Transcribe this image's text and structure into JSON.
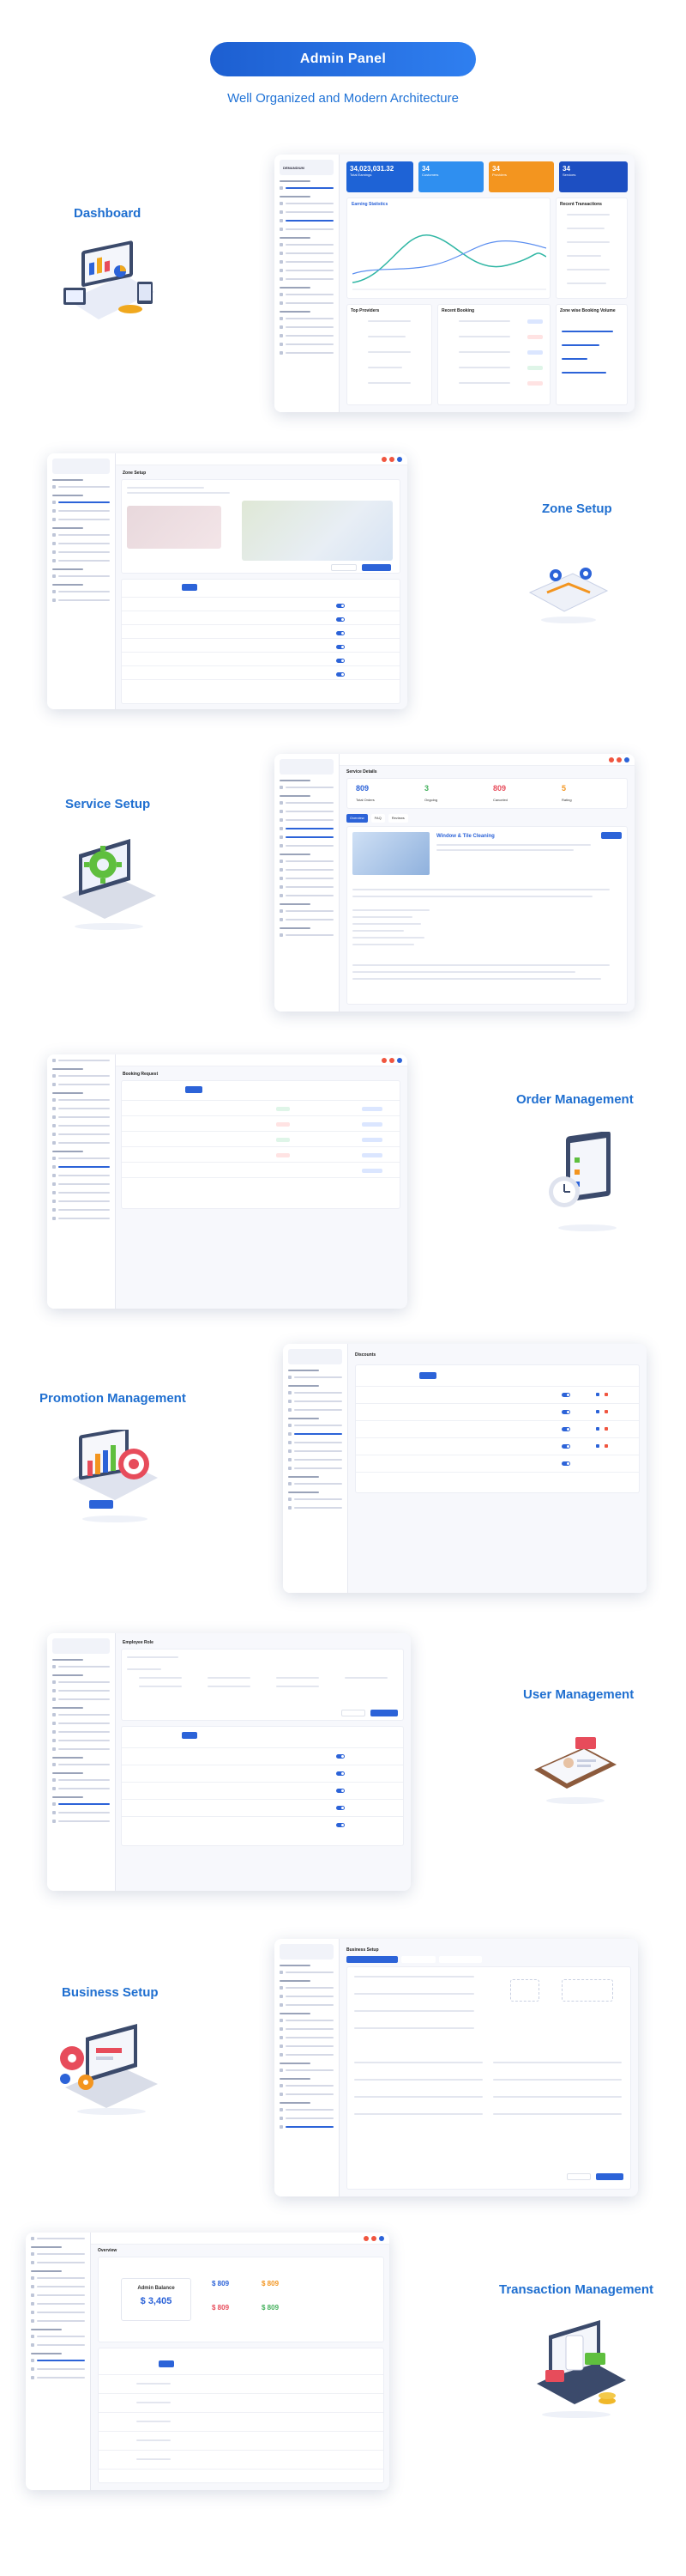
{
  "hero": {
    "button_label": "Admin Panel",
    "subtitle": "Well Organized and Modern Architecture"
  },
  "sections": [
    {
      "title": "Dashboard"
    },
    {
      "title": "Zone Setup"
    },
    {
      "title": "Service Setup"
    },
    {
      "title": "Order Management"
    },
    {
      "title": "Promotion Management"
    },
    {
      "title": "User Management"
    },
    {
      "title": "Business Setup"
    },
    {
      "title": "Transaction Management"
    }
  ],
  "dashboard": {
    "stat1_value": "34,023,031.32",
    "stat1_label": "Total Earnings",
    "stat2_value": "34",
    "stat2_label": "Customers",
    "stat3_value": "34",
    "stat3_label": "Providers",
    "stat4_value": "34",
    "stat4_label": "Services",
    "chart_title": "Earning Statistics",
    "recent_title": "Recent Transactions",
    "top_title": "Top Providers",
    "recent_booking_title": "Recent Booking",
    "zone_title": "Zone wise Booking Volume",
    "logo_text": "DEMANDIUM"
  },
  "zone": {
    "page_title": "Zone Setup"
  },
  "service": {
    "page_title": "Service Details",
    "n1": "809",
    "l1": "Total Orders",
    "n2": "3",
    "l2": "Ongoing",
    "n3": "809",
    "l3": "Canceled",
    "n4": "5",
    "l4": "Rating",
    "item_title": "Window & Tile Cleaning",
    "tab1": "Overview",
    "tab2": "FAQ",
    "tab3": "Reviews"
  },
  "order": {
    "page_title": "Booking Request"
  },
  "promotion": {
    "page_title": "Discounts"
  },
  "user": {
    "page_title": "Employee Role"
  },
  "business": {
    "page_title": "Business Setup"
  },
  "transaction": {
    "page_title": "Overview",
    "balance_label": "Admin Balance",
    "balance_value": "$ 3,405",
    "c1": "$ 809",
    "c2": "$ 809",
    "c3": "$ 809",
    "c4": "$ 809"
  },
  "colors": {
    "primary": "#2c63d8",
    "heading": "#1f6fd0",
    "stat_blue": "#1e63d6",
    "stat_teal": "#2f8ff0",
    "stat_orange": "#f3951f",
    "stat_navy": "#1d4fc2"
  }
}
